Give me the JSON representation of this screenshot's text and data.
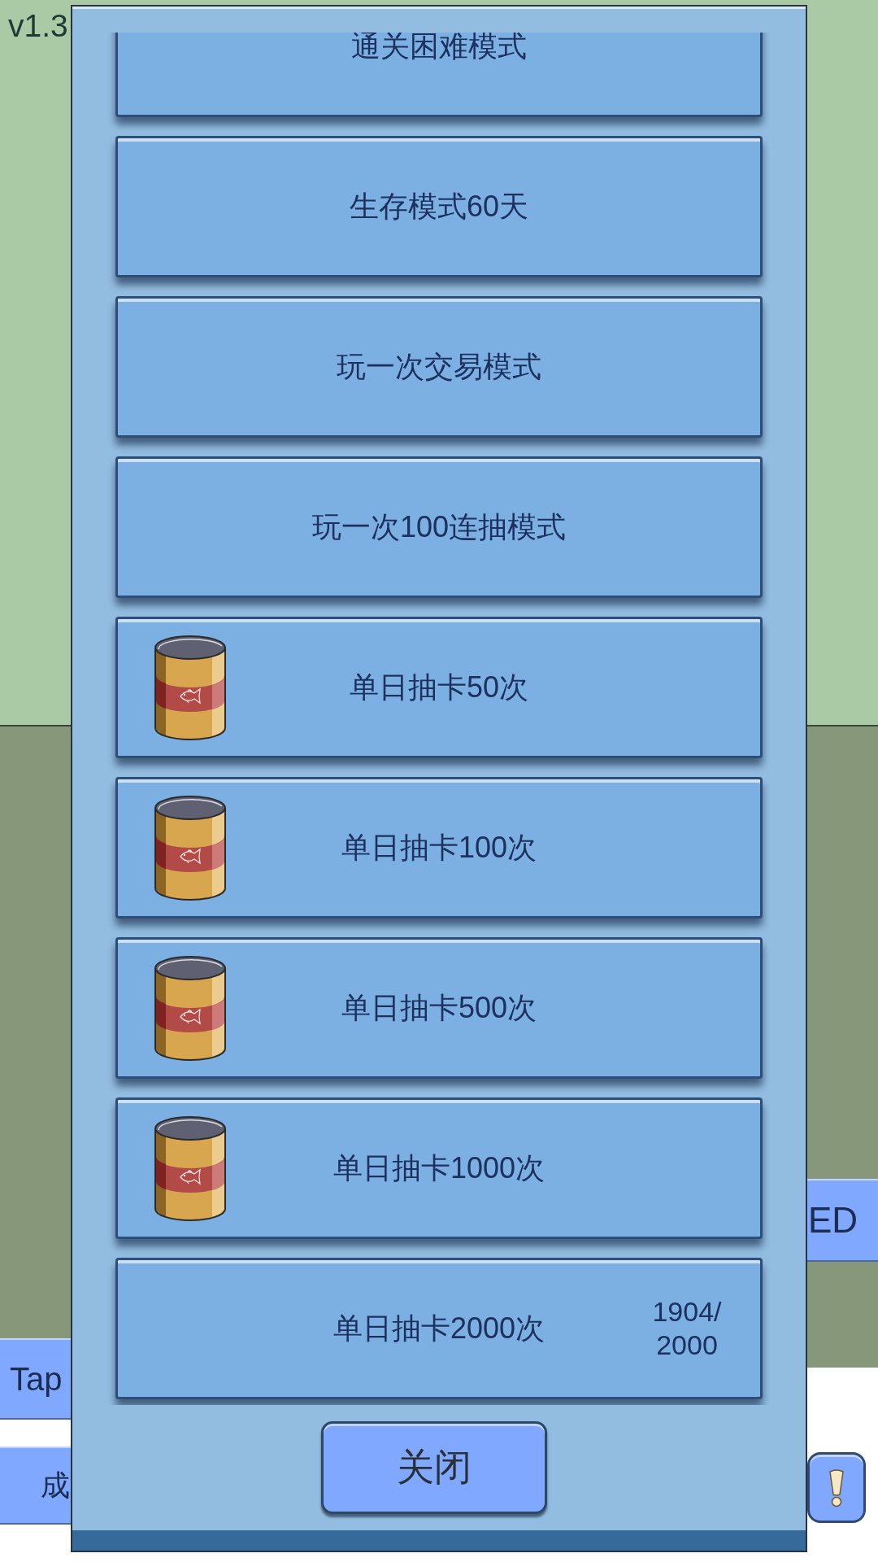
{
  "version": "v1.3",
  "dialog": {
    "items": [
      {
        "kind": "plain",
        "title": "通关困难模式"
      },
      {
        "kind": "plain",
        "title": "生存模式60天"
      },
      {
        "kind": "plain",
        "title": "玩一次交易模式"
      },
      {
        "kind": "plain",
        "title": "玩一次100连抽模式"
      },
      {
        "kind": "reward",
        "title": "单日抽卡50次"
      },
      {
        "kind": "reward",
        "title": "单日抽卡100次"
      },
      {
        "kind": "reward",
        "title": "单日抽卡500次"
      },
      {
        "kind": "reward",
        "title": "单日抽卡1000次"
      },
      {
        "kind": "progress",
        "title": "单日抽卡2000次",
        "progress": "1904/2000"
      }
    ],
    "close_button": "关闭"
  },
  "side_buttons": {
    "left": [
      "Tap",
      "成"
    ],
    "right": [
      "ED"
    ]
  }
}
